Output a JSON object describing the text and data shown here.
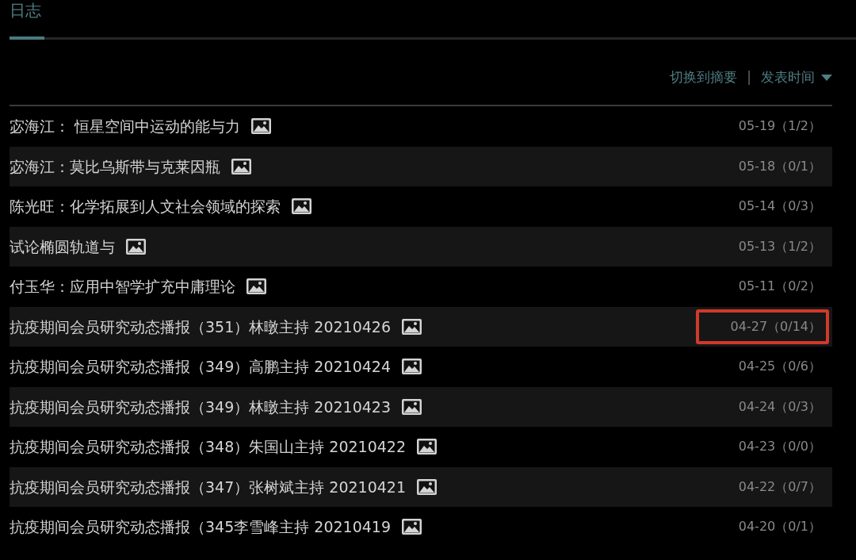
{
  "tabs": [
    {
      "label": "日志",
      "selected": true
    }
  ],
  "toolbar": {
    "switch_link": "切换到摘要",
    "separator": "|",
    "sort_label": "发表时间"
  },
  "entries": [
    {
      "title": "宓海江： 恒星空间中运动的能与力",
      "date": "05-19（1/2）",
      "highlighted": false
    },
    {
      "title": "宓海江：莫比乌斯带与克莱因瓶",
      "date": "05-18（0/1）",
      "highlighted": false
    },
    {
      "title": "陈光旺：化学拓展到人文社会领域的探索",
      "date": "05-14（0/3）",
      "highlighted": false
    },
    {
      "title": "试论椭圆轨道与",
      "date": "05-13（1/2）",
      "highlighted": false
    },
    {
      "title": "付玉华：应用中智学扩充中庸理论",
      "date": "05-11（0/2）",
      "highlighted": false
    },
    {
      "title": "抗疫期间会员研究动态播报（351）林暾主持 20210426",
      "date": "04-27（0/14）",
      "highlighted": true
    },
    {
      "title": "抗疫期间会员研究动态播报（349）高鹏主持 20210424",
      "date": "04-25（0/6）",
      "highlighted": false
    },
    {
      "title": "抗疫期间会员研究动态播报（349）林暾主持 20210423",
      "date": "04-24（0/3）",
      "highlighted": false
    },
    {
      "title": "抗疫期间会员研究动态播报（348）朱国山主持 20210422",
      "date": "04-23（0/0）",
      "highlighted": false
    },
    {
      "title": "抗疫期间会员研究动态播报（347）张树斌主持 20210421",
      "date": "04-22（0/7）",
      "highlighted": false
    },
    {
      "title": "抗疫期间会员研究动态播报（345李雪峰主持 20210419",
      "date": "04-20（0/1）",
      "highlighted": false
    }
  ]
}
